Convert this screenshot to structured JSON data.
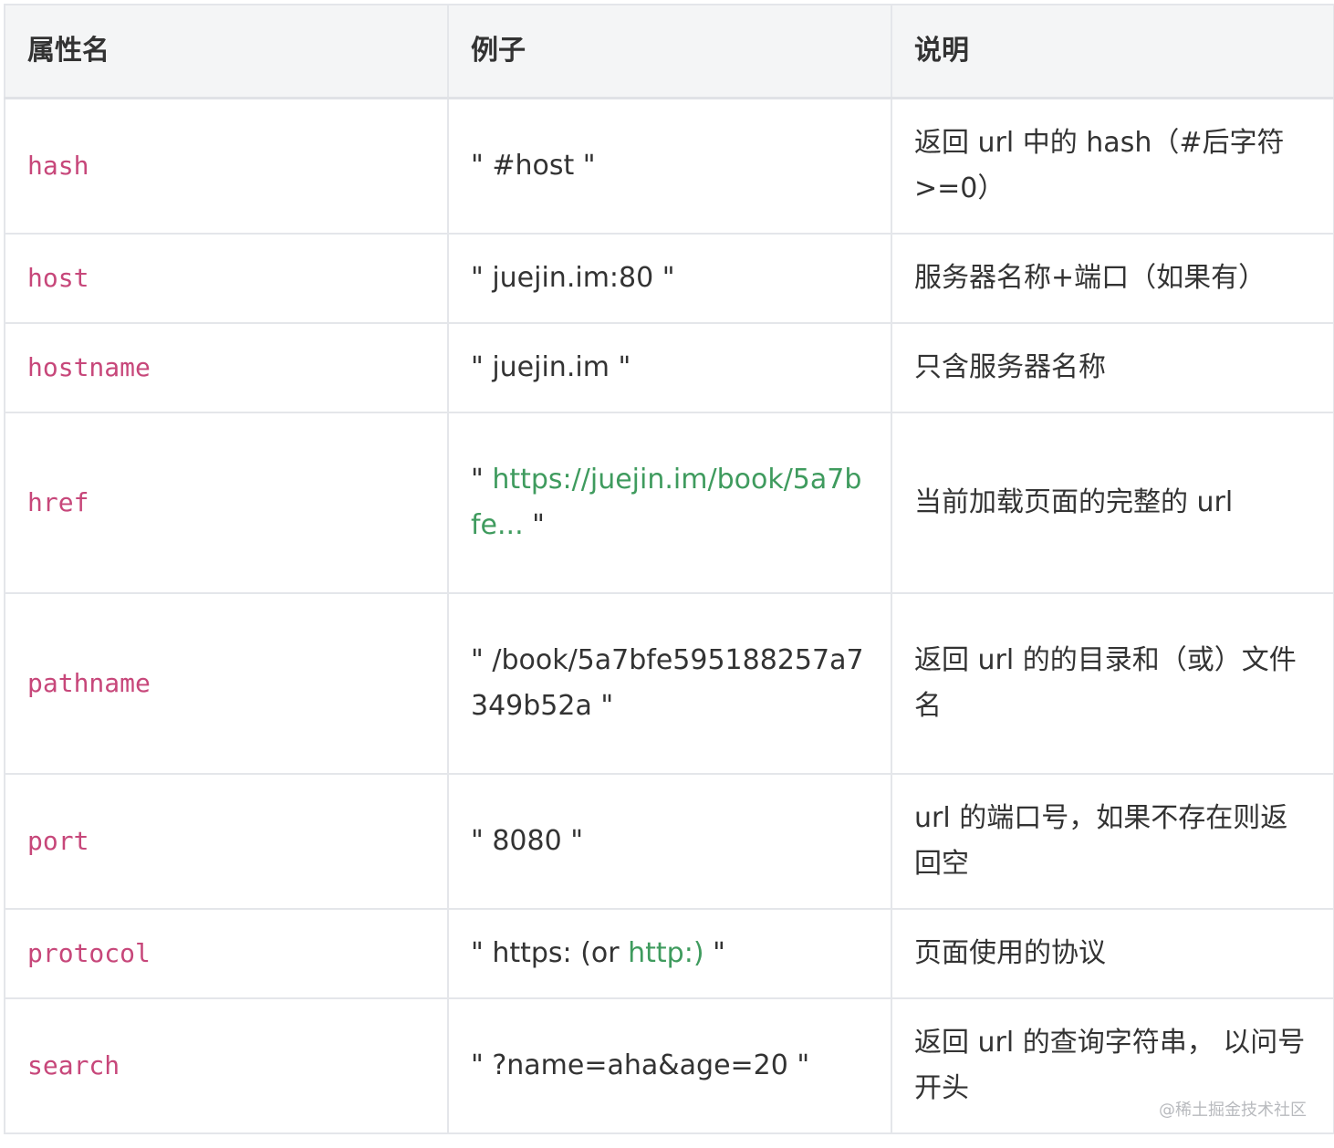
{
  "table": {
    "headers": [
      "属性名",
      "例子",
      "说明"
    ],
    "rows": [
      {
        "name": "hash",
        "example": "\" #host \"",
        "description": "返回 url 中的 hash（#后字符 >=0）"
      },
      {
        "name": "host",
        "example": "\" juejin.im:80 \"",
        "description": "服务器名称+端口（如果有）"
      },
      {
        "name": "hostname",
        "example": "\" juejin.im \"",
        "description": "只含服务器名称"
      },
      {
        "name": "href",
        "example_prefix": "\" ",
        "example_link": "https://juejin.im/book/5a7bfe...",
        "example_suffix": " \"",
        "description": "当前加载页面的完整的 url"
      },
      {
        "name": "pathname",
        "example": "\" /book/5a7bfe595188257a7349b52a \"",
        "description": "返回 url 的的目录和（或）文件名"
      },
      {
        "name": "port",
        "example": "\" 8080 \"",
        "description": "url 的端口号，如果不存在则返回空"
      },
      {
        "name": "protocol",
        "example_prefix": "\" https: (or ",
        "example_link": "http:)",
        "example_suffix": " \"",
        "description": "页面使用的协议"
      },
      {
        "name": "search",
        "example": "\" ?name=aha&age=20 \"",
        "description": "返回 url 的查询字符串， 以问号开头"
      }
    ]
  },
  "watermark": "@稀土掘金技术社区",
  "colors": {
    "property_name": "#c7477a",
    "link": "#3f9b5e",
    "header_bg": "#f4f5f6",
    "border": "#e4e6ea"
  }
}
